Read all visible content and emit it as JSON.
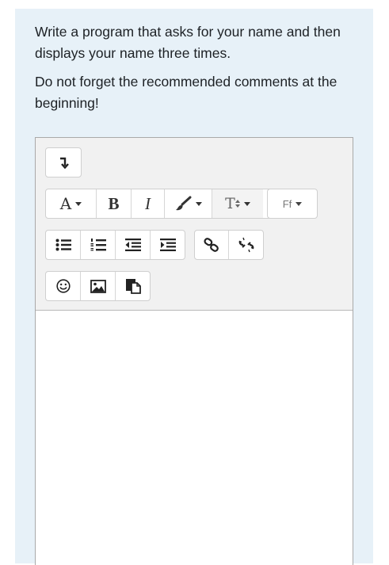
{
  "question": {
    "line1": "Write a program that asks for your name and then displays your name three times.",
    "line2": "Do not forget the recommended comments at the beginning!"
  },
  "toolbar": {
    "font_family_label": "A",
    "bold_label": "B",
    "italic_label": "I",
    "text_style_label": "T",
    "font_size_label": "Ff"
  },
  "editor": {
    "content": ""
  }
}
